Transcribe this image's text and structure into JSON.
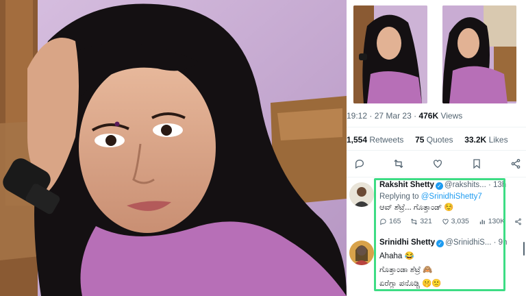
{
  "tweet": {
    "time": "19:12",
    "date": "27 Mar 23",
    "views_count": "476K",
    "views_label": "Views",
    "retweets_count": "1,554",
    "retweets_label": "Retweets",
    "quotes_count": "75",
    "quotes_label": "Quotes",
    "likes_count": "33.2K",
    "likes_label": "Likes"
  },
  "actions": [
    "reply-icon",
    "retweet-icon",
    "like-icon",
    "bookmark-icon",
    "share-icon"
  ],
  "replies": [
    {
      "name": "Rakshit Shetty",
      "handle": "@rakshits...",
      "time": "· 13h",
      "replying_prefix": "Replying to",
      "replying_to": "@SrinidhiShetty7",
      "text": "ಆವ್ ಶೆಟ್ರೆ... ಗೊತ್ತಾಂಡ್ ☺️",
      "replies": "165",
      "retweets": "321",
      "likes": "3,035",
      "views": "130K"
    },
    {
      "name": "Srinidhi Shetty",
      "handle": "@SrinidhiS...",
      "time": "· 9h",
      "text_line1": "Ahaha 😂",
      "text_line2": "ಗೊತ್ತಾಂಡಾ ಶೆಟ್ರೆ 🙈",
      "text_line3": "ಏರೆಗ್ಲಾ ಪನೊಡ್ಚಿ 🤫🙁"
    }
  ],
  "colors": {
    "highlight": "#3ddc84",
    "link": "#1d9bf0",
    "muted": "#536471"
  }
}
